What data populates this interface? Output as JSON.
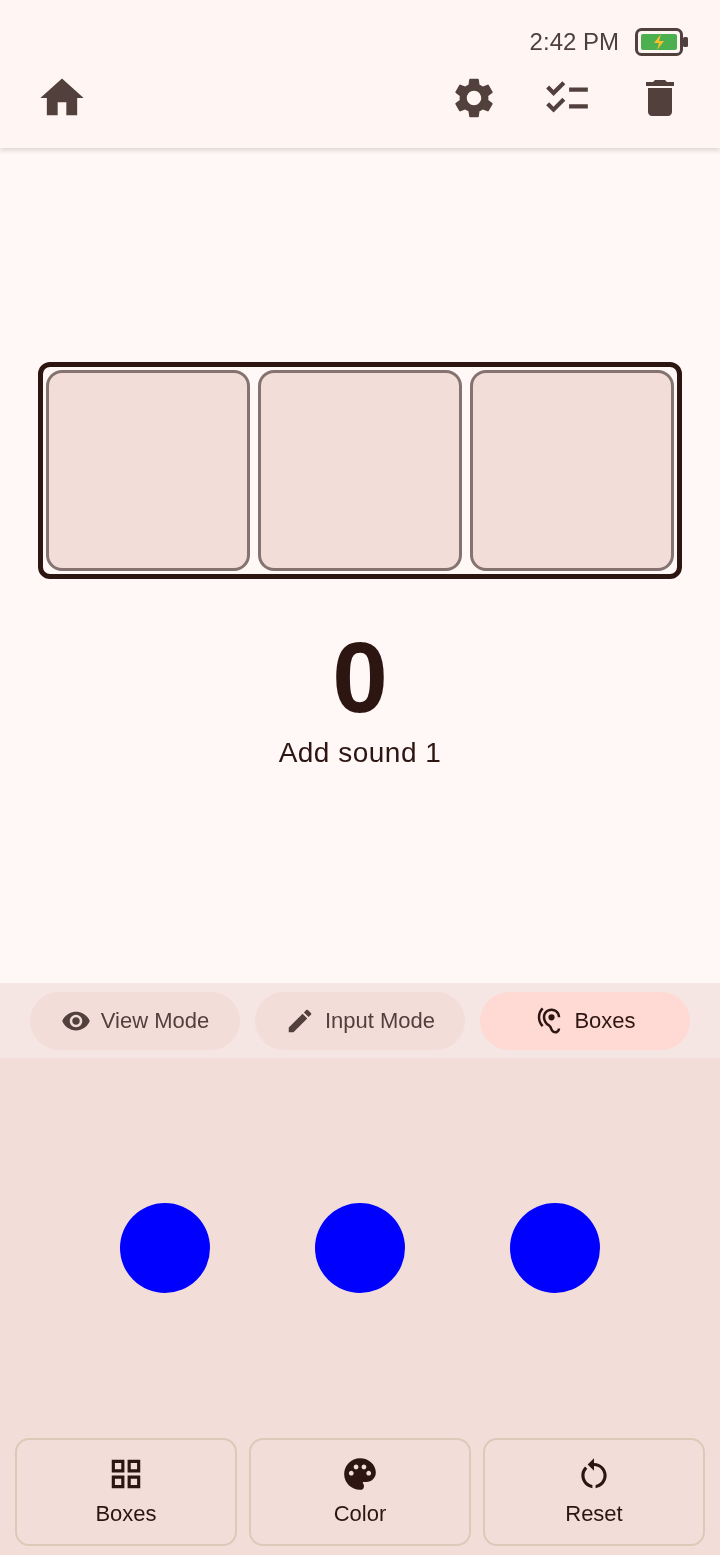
{
  "status_bar": {
    "time": "2:42 PM"
  },
  "boxes": {
    "slots": [
      {
        "filled": false
      },
      {
        "filled": false
      },
      {
        "filled": false
      }
    ]
  },
  "counter": {
    "value": "0",
    "hint": "Add sound 1"
  },
  "modes": [
    {
      "label": "View Mode",
      "selected": false
    },
    {
      "label": "Input Mode",
      "selected": false
    },
    {
      "label": "Boxes",
      "selected": true
    }
  ],
  "dots": [
    {
      "color": "#0000ff"
    },
    {
      "color": "#0000ff"
    },
    {
      "color": "#0000ff"
    }
  ],
  "actions": [
    "Boxes",
    "Color",
    "Reset"
  ]
}
